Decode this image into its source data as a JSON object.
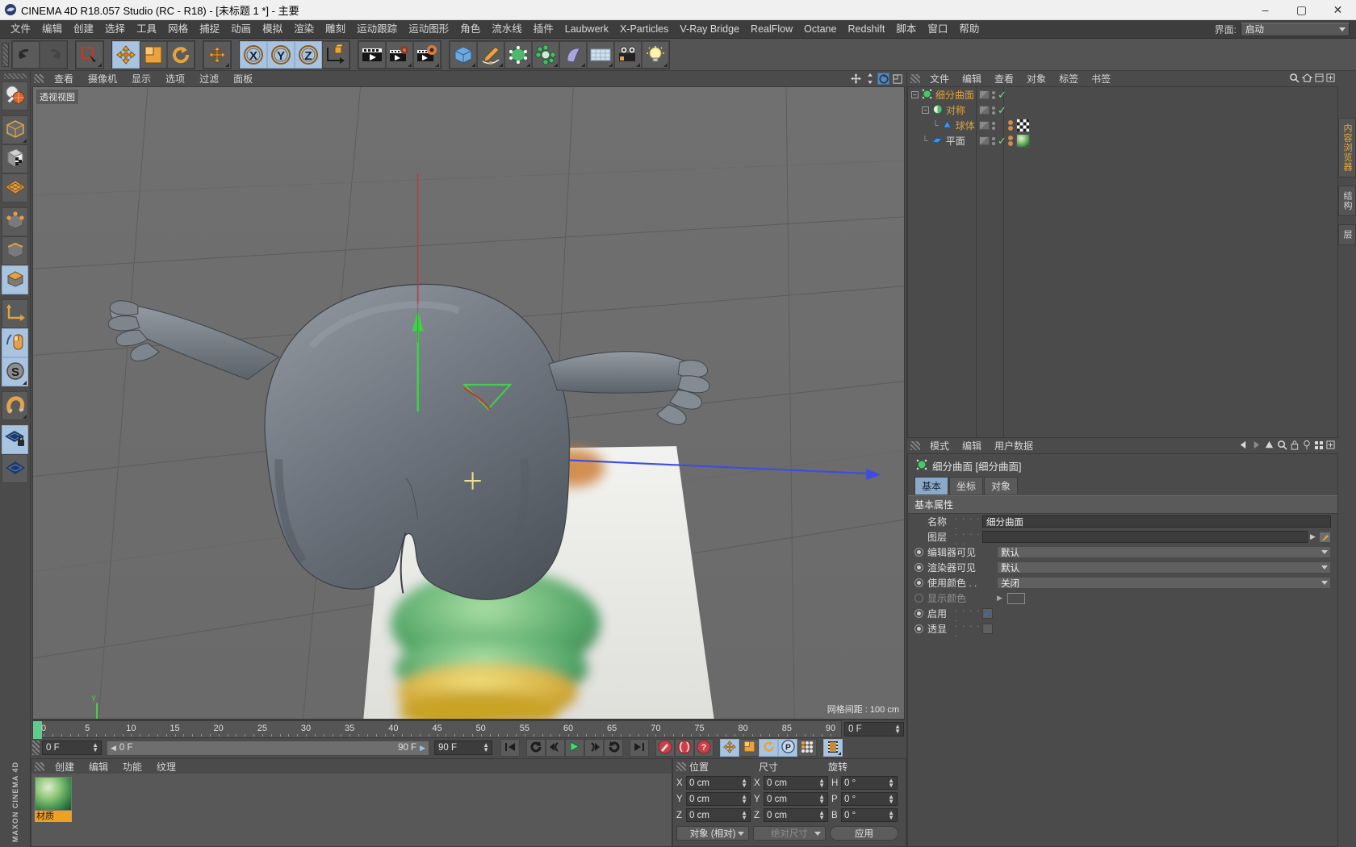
{
  "titlebar": {
    "app_icon": "c4d-logo-icon",
    "title": "CINEMA 4D R18.057 Studio (RC - R18) - [未标题 1 *] - 主要",
    "minimize": "–",
    "maximize": "▢",
    "close": "✕"
  },
  "menubar": {
    "items": [
      "文件",
      "编辑",
      "创建",
      "选择",
      "工具",
      "网格",
      "捕捉",
      "动画",
      "模拟",
      "渲染",
      "雕刻",
      "运动跟踪",
      "运动图形",
      "角色",
      "流水线",
      "插件",
      "Laubwerk",
      "X-Particles",
      "V-Ray Bridge",
      "RealFlow",
      "Octane",
      "Redshift",
      "脚本",
      "窗口",
      "帮助"
    ],
    "layout_label": "界面:",
    "layout_value": "启动"
  },
  "toolbar": {
    "groups": [
      {
        "name": "history",
        "buttons": [
          {
            "name": "undo-button",
            "icon": "undo-icon",
            "state": "normal"
          },
          {
            "name": "redo-button",
            "icon": "redo-icon",
            "state": "disabled"
          }
        ]
      },
      {
        "name": "selection",
        "buttons": [
          {
            "name": "live-selection-button",
            "icon": "live-selection-icon",
            "state": "normal",
            "flyout": true
          }
        ]
      },
      {
        "name": "transform",
        "buttons": [
          {
            "name": "move-tool-button",
            "icon": "move-icon",
            "state": "active"
          },
          {
            "name": "scale-tool-button",
            "icon": "scale-icon",
            "state": "normal"
          },
          {
            "name": "rotate-tool-button",
            "icon": "rotate-icon",
            "state": "normal"
          }
        ]
      },
      {
        "name": "move-extra",
        "buttons": [
          {
            "name": "move-duplicate-button",
            "icon": "move-icon",
            "state": "normal",
            "flyout": true
          }
        ]
      },
      {
        "name": "axis-locks",
        "buttons": [
          {
            "name": "lock-x-button",
            "icon": "axis-x-icon",
            "state": "active"
          },
          {
            "name": "lock-y-button",
            "icon": "axis-y-icon",
            "state": "active"
          },
          {
            "name": "lock-z-button",
            "icon": "axis-z-icon",
            "state": "active"
          },
          {
            "name": "world-object-coord-button",
            "icon": "world-axis-icon",
            "state": "normal"
          }
        ]
      },
      {
        "name": "render",
        "buttons": [
          {
            "name": "render-view-button",
            "icon": "render-view-icon",
            "state": "normal"
          },
          {
            "name": "render-region-button",
            "icon": "render-region-icon",
            "state": "normal",
            "flyout": true
          },
          {
            "name": "render-settings-button",
            "icon": "render-settings-icon",
            "state": "normal",
            "flyout": true
          }
        ]
      },
      {
        "name": "create",
        "buttons": [
          {
            "name": "add-cube-button",
            "icon": "cube-icon",
            "state": "normal",
            "flyout": true
          },
          {
            "name": "add-spline-button",
            "icon": "pen-spline-icon",
            "state": "normal",
            "flyout": true
          },
          {
            "name": "add-nurbs-button",
            "icon": "subdivision-surface-icon",
            "state": "normal",
            "flyout": true
          },
          {
            "name": "add-array-button",
            "icon": "array-modeling-icon",
            "state": "normal",
            "flyout": true
          },
          {
            "name": "add-deformer-button",
            "icon": "bend-deformer-icon",
            "state": "normal",
            "flyout": true
          },
          {
            "name": "add-floor-button",
            "icon": "floor-environment-icon",
            "state": "normal",
            "flyout": true
          },
          {
            "name": "add-camera-button",
            "icon": "camera-icon",
            "state": "normal",
            "flyout": true
          },
          {
            "name": "add-light-button",
            "icon": "light-bulb-icon",
            "state": "normal",
            "flyout": true
          }
        ]
      }
    ]
  },
  "leftbar": {
    "buttons": [
      {
        "name": "make-editable-button",
        "icon": "make-editable-icon",
        "state": "normal"
      },
      {
        "name": "model-mode-button",
        "icon": "model-mode-icon",
        "state": "normal",
        "flyout": true
      },
      {
        "name": "texture-mode-button",
        "icon": "texture-mode-icon",
        "state": "normal"
      },
      {
        "name": "workplane-button",
        "icon": "workplane-icon",
        "state": "normal"
      },
      {
        "name": "point-mode-button",
        "icon": "point-mode-icon",
        "state": "normal"
      },
      {
        "name": "edge-mode-button",
        "icon": "edge-mode-icon",
        "state": "normal"
      },
      {
        "name": "polygon-mode-button",
        "icon": "polygon-mode-icon",
        "state": "active"
      },
      {
        "name": "axis-modify-button",
        "icon": "axis-modify-icon",
        "state": "normal"
      },
      {
        "name": "enable-axis-button",
        "icon": "mouse-axis-icon",
        "state": "active"
      },
      {
        "name": "snap-settings-button",
        "icon": "snap-s-icon",
        "state": "active",
        "flyout": true
      },
      {
        "name": "magnet-button",
        "icon": "magnet-icon",
        "state": "normal",
        "flyout": true
      },
      {
        "name": "lock-workplane-button",
        "icon": "workplane-lock-icon",
        "state": "active"
      },
      {
        "name": "workplane-transform-button",
        "icon": "workplane-transform-icon",
        "state": "normal"
      }
    ],
    "brand": "MAXON CINEMA 4D"
  },
  "viewport": {
    "menu": [
      "查看",
      "摄像机",
      "显示",
      "选项",
      "过滤",
      "面板"
    ],
    "label": "透视视图",
    "grid_info": "网格间距 : 100 cm",
    "nav_icons": [
      "pan-icon",
      "zoom-icon",
      "orbit-icon",
      "maximize-viewport-icon"
    ]
  },
  "timeline": {
    "ticks": [
      0,
      5,
      10,
      15,
      20,
      25,
      30,
      35,
      40,
      45,
      50,
      55,
      60,
      65,
      70,
      75,
      80,
      85,
      90
    ],
    "current_frame_label": "0 F",
    "playhead_frame": 0,
    "start_field": "0 F",
    "range_start": "0 F",
    "range_end": "90 F",
    "end_field": "90 F"
  },
  "transport": {
    "buttons": [
      {
        "name": "goto-start-button",
        "icon": "skip-start-icon",
        "state": "normal"
      },
      {
        "name": "prev-key-button",
        "icon": "prev-key-icon",
        "state": "normal"
      },
      {
        "name": "prev-frame-button",
        "icon": "step-back-icon",
        "state": "normal"
      },
      {
        "name": "play-button",
        "icon": "play-icon",
        "state": "normal"
      },
      {
        "name": "next-frame-button",
        "icon": "step-forward-icon",
        "state": "normal"
      },
      {
        "name": "next-key-button",
        "icon": "next-key-icon",
        "state": "normal"
      },
      {
        "name": "goto-end-button",
        "icon": "skip-end-icon",
        "state": "normal"
      },
      {
        "name": "record-active-objects-button",
        "icon": "record-key-icon",
        "state": "normal"
      },
      {
        "name": "autokeying-button",
        "icon": "autokey-icon",
        "state": "normal"
      },
      {
        "name": "keyframe-selection-button",
        "icon": "keyframe-question-icon",
        "state": "normal"
      },
      {
        "name": "record-position-button",
        "icon": "position-key-icon",
        "state": "active"
      },
      {
        "name": "record-scale-button",
        "icon": "scale-key-icon",
        "state": "normal"
      },
      {
        "name": "record-rotation-button",
        "icon": "rotation-key-icon",
        "state": "active"
      },
      {
        "name": "record-pla-button",
        "icon": "pla-key-icon",
        "state": "active"
      },
      {
        "name": "record-parameter-button",
        "icon": "param-key-icon",
        "state": "normal"
      },
      {
        "name": "timeline-toggle-button",
        "icon": "filmstrip-icon",
        "state": "active"
      }
    ]
  },
  "material_manager": {
    "menu": [
      "创建",
      "编辑",
      "功能",
      "纹理"
    ],
    "materials": [
      {
        "name": "材质",
        "preview": "green-sphere-preview"
      }
    ]
  },
  "coordinate_manager": {
    "headers": [
      "位置",
      "尺寸",
      "旋转"
    ],
    "rows": [
      {
        "pos_axis": "X",
        "pos_value": "0 cm",
        "size_axis": "X",
        "size_value": "0 cm",
        "rot_axis": "H",
        "rot_value": "0 °"
      },
      {
        "pos_axis": "Y",
        "pos_value": "0 cm",
        "size_axis": "Y",
        "size_value": "0 cm",
        "rot_axis": "P",
        "rot_value": "0 °"
      },
      {
        "pos_axis": "Z",
        "pos_value": "0 cm",
        "size_axis": "Z",
        "size_value": "0 cm",
        "rot_axis": "B",
        "rot_value": "0 °"
      }
    ],
    "mode_select": "对象 (相对)",
    "size_select": "绝对尺寸",
    "apply_button": "应用"
  },
  "object_manager": {
    "menu": [
      "文件",
      "编辑",
      "查看",
      "对象",
      "标签",
      "书签"
    ],
    "items": [
      {
        "name": "细分曲面",
        "icon": "subdivision-surface-icon",
        "depth": 0,
        "expander": "−",
        "selected": true,
        "enabled_check": true,
        "tags": []
      },
      {
        "name": "对称",
        "icon": "symmetry-icon",
        "depth": 1,
        "expander": "−",
        "selected": false,
        "enabled_check": true,
        "tags": []
      },
      {
        "name": "球体",
        "icon": "sphere-primitive-icon",
        "depth": 2,
        "expander": "",
        "selected": false,
        "enabled_check": false,
        "tags": [
          "checker-tag"
        ]
      },
      {
        "name": "平面",
        "icon": "plane-primitive-icon",
        "depth": 0,
        "expander": "",
        "selected": false,
        "enabled_check": true,
        "tags": [
          "material-tag"
        ]
      }
    ]
  },
  "attribute_manager": {
    "menu": [
      "模式",
      "编辑",
      "用户数据"
    ],
    "object_title": "细分曲面 [细分曲面]",
    "tabs": [
      {
        "label": "基本",
        "selected": true
      },
      {
        "label": "坐标",
        "selected": false
      },
      {
        "label": "对象",
        "selected": false
      }
    ],
    "section_title": "基本属性",
    "fields": [
      {
        "label": "名称",
        "dots": ". . . . .",
        "value": "细分曲面",
        "type": "text",
        "radio": "none"
      },
      {
        "label": "图层",
        "dots": ". . . . . .",
        "value": "",
        "type": "layer",
        "radio": "none"
      },
      {
        "label": "编辑器可见",
        "dots": "",
        "value": "默认",
        "type": "dropdown",
        "radio": "on"
      },
      {
        "label": "渲染器可见",
        "dots": "",
        "value": "默认",
        "type": "dropdown",
        "radio": "on"
      },
      {
        "label": "使用颜色 . .",
        "dots": "",
        "value": "关闭",
        "type": "dropdown",
        "radio": "on"
      },
      {
        "label": "显示颜色",
        "dots": "",
        "value": "",
        "type": "color",
        "radio": "dim"
      },
      {
        "label": "启用",
        "dots": ". . . . .",
        "value": "checked",
        "type": "checkbox",
        "radio": "on"
      },
      {
        "label": "透显",
        "dots": ". . . . .",
        "value": "unchecked",
        "type": "checkbox",
        "radio": "on"
      }
    ]
  },
  "far_right_tabs": [
    {
      "label": "内容浏览器",
      "color": "orange"
    },
    {
      "label": "结构",
      "color": "grey"
    },
    {
      "label": "层",
      "color": "grey"
    }
  ]
}
